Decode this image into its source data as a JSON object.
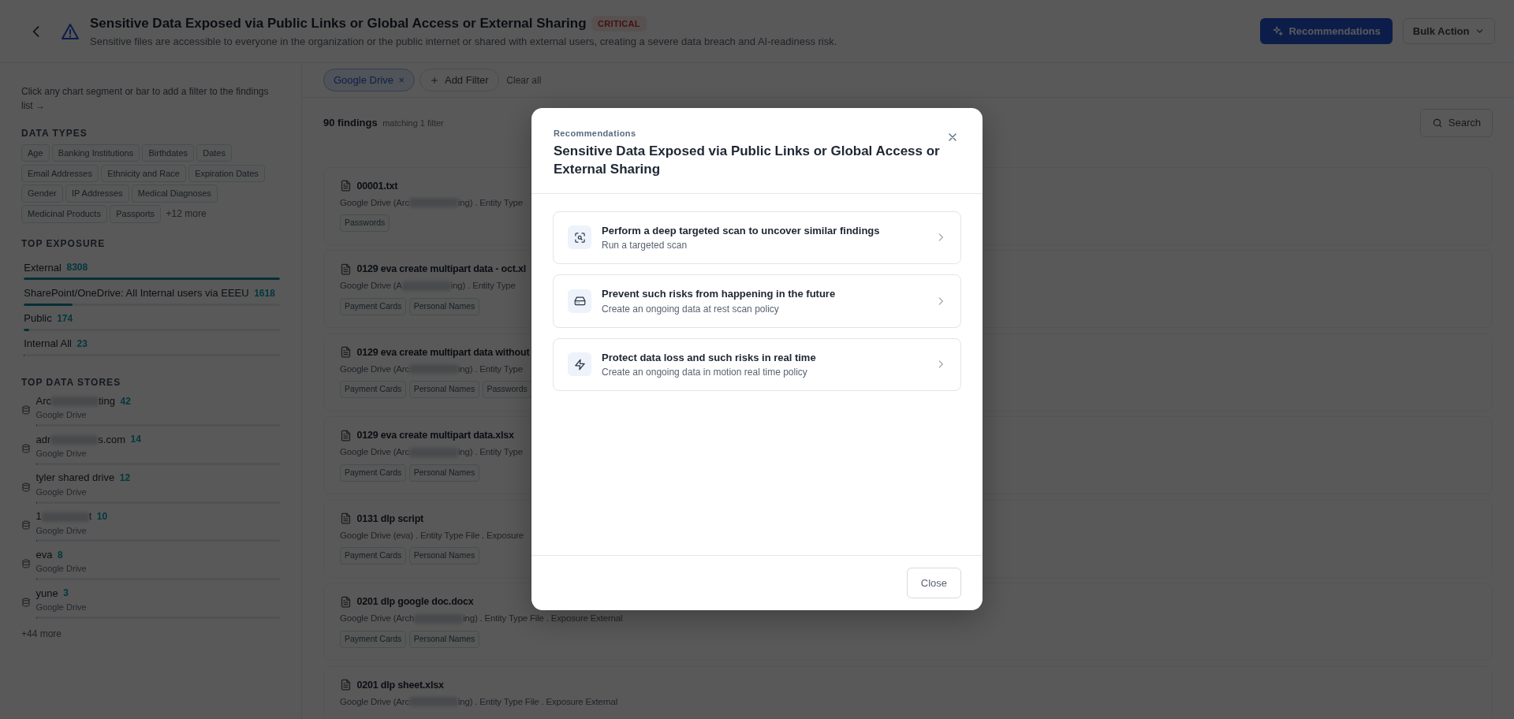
{
  "header": {
    "title": "Sensitive Data Exposed via Public Links or Global Access or External Sharing",
    "severity": "CRITICAL",
    "description": "Sensitive files are accessible to everyone in the organization or the public internet or shared with external users, creating a severe data breach and AI-readiness risk.",
    "primary_button": "Recommendations",
    "secondary_button": "Bulk Action"
  },
  "sidebar": {
    "hint": "Click any chart segment or bar to add a filter to the findings list →",
    "data_types": {
      "title": "DATA TYPES",
      "tags": [
        "Age",
        "Banking Institutions",
        "Birthdates",
        "Dates",
        "Email Addresses",
        "Ethnicity and Race",
        "Expiration Dates",
        "Gender",
        "IP Addresses",
        "Medical Diagnoses",
        "Medicinal Products",
        "Passports"
      ],
      "more": "+12 more"
    },
    "top_exposure": {
      "title": "TOP EXPOSURE",
      "items": [
        {
          "label": "External",
          "count": "8308",
          "level": 1
        },
        {
          "label": "SharePoint/OneDrive: All Internal users via EEEU",
          "count": "1618",
          "level": 0.19
        },
        {
          "label": "Public",
          "count": "174",
          "level": 0.02
        },
        {
          "label": "Internal All",
          "count": "23",
          "level": 0.003
        }
      ]
    },
    "top_data_stores": {
      "title": "TOP DATA STORES",
      "items": [
        {
          "name_parts": [
            "Arc",
            "ting"
          ],
          "count": "42",
          "source": "Google Drive",
          "level": 0.005
        },
        {
          "name_parts": [
            "adr",
            "s.com"
          ],
          "count": "14",
          "source": "Google Drive",
          "level": 0.004
        },
        {
          "name_parts": [
            "tyler shared drive"
          ],
          "count": "12",
          "source": "Google Drive",
          "level": 0.004
        },
        {
          "name_parts": [
            "1",
            "t"
          ],
          "count": "10",
          "source": "Google Drive",
          "level": 0.003
        },
        {
          "name_parts": [
            "eva"
          ],
          "count": "8",
          "source": "Google Drive",
          "level": 0.003
        },
        {
          "name_parts": [
            "yune"
          ],
          "count": "3",
          "source": "Google Drive",
          "level": 0.002
        }
      ],
      "more": "+44 more"
    }
  },
  "filters": {
    "chips": [
      {
        "label": "Google Drive",
        "remove": "×"
      }
    ],
    "add": "Add Filter",
    "clear": "Clear all"
  },
  "findings": {
    "count": "90 findings",
    "matching": "matching 1 filter",
    "search": "Search",
    "items": [
      {
        "name": "00001.txt",
        "meta_parts": [
          "Google Drive (Arc",
          "ing) . Entity Type"
        ],
        "tags": [
          "Passwords"
        ]
      },
      {
        "name": "0129 eva create multipart data - oct.xl",
        "meta_parts": [
          "Google Drive (A",
          "ing) . Entity Type"
        ],
        "tags": [
          "Payment Cards",
          "Personal Names"
        ]
      },
      {
        "name": "0129 eva create multipart data without",
        "meta_parts": [
          "Google Drive (Arc",
          "ing) . Entity Type"
        ],
        "tags": [
          "Payment Cards",
          "Personal Names",
          "Passwords"
        ]
      },
      {
        "name": "0129 eva create multipart data.xlsx",
        "meta_parts": [
          "Google Drive (Arc",
          "ing) . Entity Type"
        ],
        "tags": [
          "Payment Cards",
          "Personal Names"
        ]
      },
      {
        "name": "0131 dlp script",
        "meta_parts": [
          "Google Drive (eva) . Entity Type File . Exposure"
        ],
        "tags": [
          "Payment Cards",
          "Personal Names"
        ]
      },
      {
        "name": "0201 dlp google doc.docx",
        "meta_parts": [
          "Google Drive (Arch",
          "ing) . Entity Type File . Exposure External"
        ],
        "tags": [
          "Payment Cards",
          "Personal Names"
        ]
      },
      {
        "name": "0201 dlp sheet.xlsx",
        "meta_parts": [
          "Google Drive (Arc",
          "ing) . Entity Type File . Exposure External"
        ]
      }
    ]
  },
  "modal": {
    "eyebrow": "Recommendations",
    "title": "Sensitive Data Exposed via Public Links or Global Access or External Sharing",
    "options": [
      {
        "kind": "scan",
        "title": "Perform a deep targeted scan to uncover similar findings",
        "subtitle": "Run a targeted scan"
      },
      {
        "kind": "policy",
        "title": "Prevent such risks from happening in the future",
        "subtitle": "Create an ongoing data at rest scan policy"
      },
      {
        "kind": "realtime",
        "title": "Protect data loss and such risks in real time",
        "subtitle": "Create an ongoing data in motion real time policy"
      }
    ],
    "close": "Close"
  }
}
